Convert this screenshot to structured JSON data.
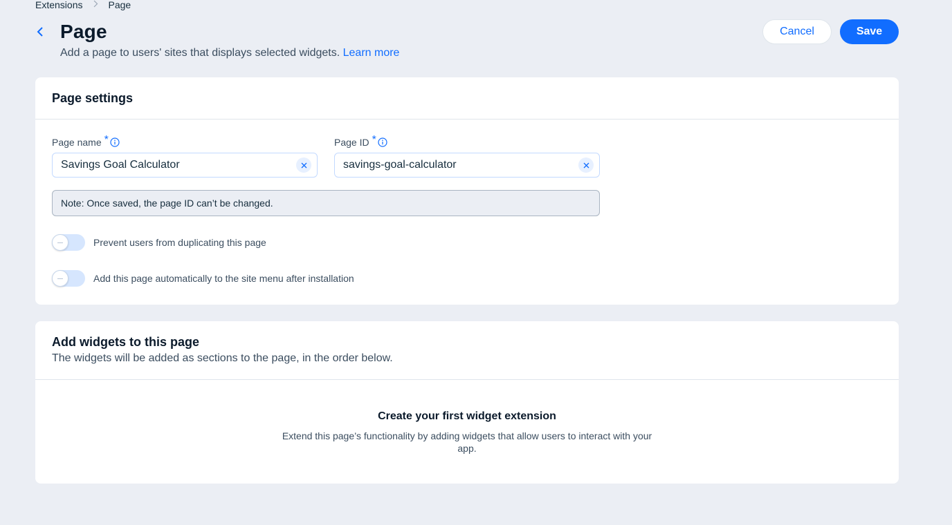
{
  "breadcrumb": {
    "items": [
      "Extensions",
      "Page"
    ]
  },
  "header": {
    "title": "Page",
    "subtitle": "Add a page to users' sites that displays selected widgets.",
    "learn_more": "Learn more",
    "cancel_label": "Cancel",
    "save_label": "Save"
  },
  "settings": {
    "title": "Page settings",
    "page_name": {
      "label": "Page name",
      "required": "*",
      "value": "Savings Goal Calculator"
    },
    "page_id": {
      "label": "Page ID",
      "required": "*",
      "value": "savings-goal-calculator"
    },
    "note": "Note: Once saved, the page ID can’t be changed.",
    "toggles": [
      {
        "label": "Prevent users from duplicating this page",
        "on": false
      },
      {
        "label": "Add this page automatically to the site menu after installation",
        "on": false
      }
    ]
  },
  "widgets": {
    "title": "Add widgets to this page",
    "subtitle": "The widgets will be added as sections to the page, in the order below.",
    "empty_title": "Create your first widget extension",
    "empty_text": "Extend this page’s functionality by adding widgets that allow users to interact with your app."
  },
  "colors": {
    "accent": "#116dff",
    "background": "#ebeef4",
    "text": "#162d3d"
  }
}
